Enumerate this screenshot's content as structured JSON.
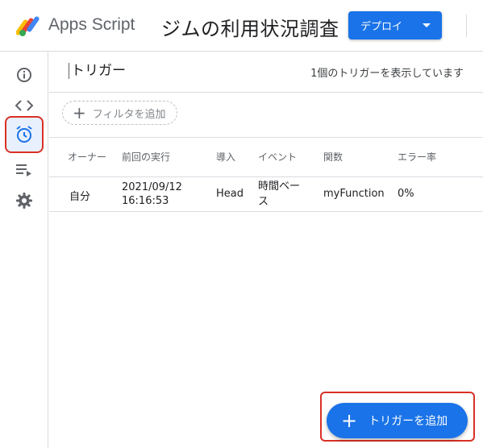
{
  "header": {
    "brand": "Apps Script",
    "project_title": "ジムの利用状況調査",
    "deploy_label": "デプロイ"
  },
  "sidebar": {
    "items": [
      {
        "name": "overview-icon",
        "active": false
      },
      {
        "name": "editor-icon",
        "active": false
      },
      {
        "name": "triggers-icon",
        "active": true
      },
      {
        "name": "executions-icon",
        "active": false
      },
      {
        "name": "settings-icon",
        "active": false
      }
    ]
  },
  "main": {
    "title": "トリガー",
    "count_text": "1個のトリガーを表示しています",
    "filter_label": "フィルタを追加",
    "table": {
      "headers": [
        "オーナー",
        "前回の実行",
        "導入",
        "イベント",
        "関数",
        "エラー率"
      ],
      "rows": [
        {
          "owner": "自分",
          "last_run_date": "2021/09/12",
          "last_run_time": "16:16:53",
          "deployment": "Head",
          "event_line1": "時間ベー",
          "event_line2": "ス",
          "function": "myFunction",
          "error_rate": "0%"
        }
      ]
    },
    "add_trigger_label": "トリガーを追加"
  },
  "colors": {
    "accent": "#1a73e8",
    "highlight": "#d93025"
  }
}
